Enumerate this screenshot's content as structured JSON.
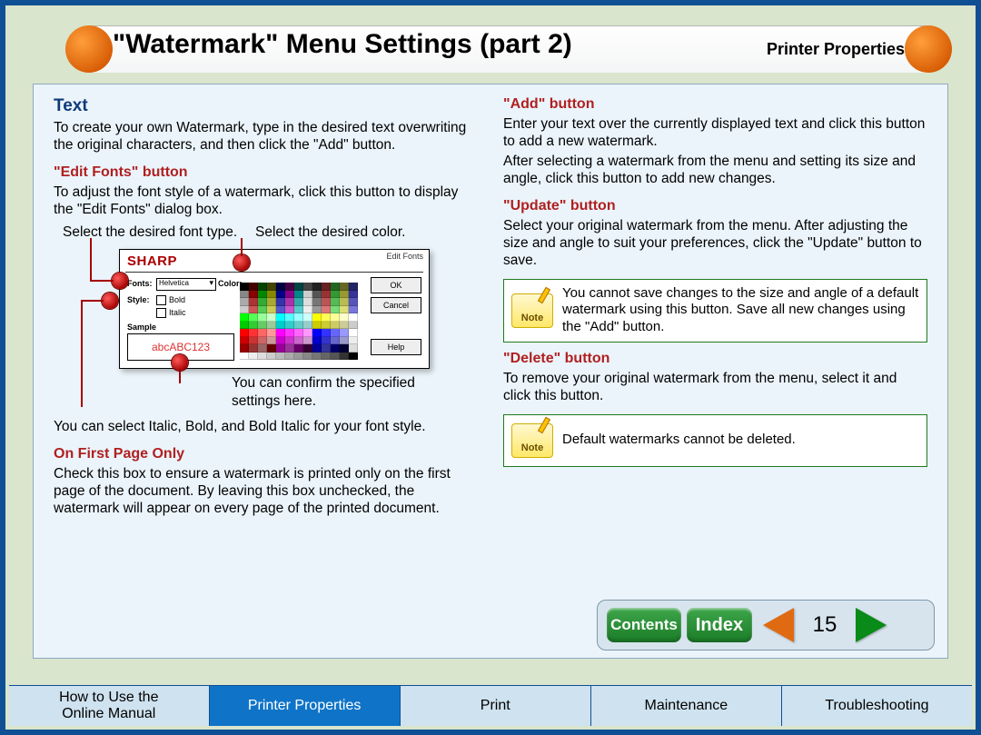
{
  "header": {
    "title": "\"Watermark\" Menu Settings (part 2)",
    "subtitle": "Printer Properties"
  },
  "left": {
    "text_heading": "Text",
    "text_body": "To create your own Watermark, type in the desired text overwriting the original characters, and then click the \"Add\" button.",
    "editfonts_heading": "\"Edit Fonts\" button",
    "editfonts_body": "To adjust the font style of a watermark, click this button to display the \"Edit Fonts\" dialog box.",
    "callout_fonttype": "Select the desired font type.",
    "callout_color": "Select the desired color.",
    "callout_confirm": "You can confirm the specified settings here.",
    "callout_style": "You can select Italic, Bold, and Bold Italic for your font style.",
    "firstpage_heading": "On First Page Only",
    "firstpage_body": "Check this box to ensure a watermark is printed only on the first page of the document. By leaving this box unchecked, the watermark will appear on every page of the printed document."
  },
  "right": {
    "add_heading": "\"Add\" button",
    "add_body1": "Enter your text over the currently displayed text and click this button to add a new watermark.",
    "add_body2": "After selecting a watermark from the menu and setting its size and angle, click this button to add new changes.",
    "update_heading": "\"Update\" button",
    "update_body": "Select your original watermark from the menu. After adjusting the size and angle to suit your preferences, click the \"Update\" button to save.",
    "note1": "You cannot save changes to the size and angle of a default watermark using this button. Save all new changes using the \"Add\" button.",
    "delete_heading": "\"Delete\" button",
    "delete_body": "To remove your original watermark from the menu, select it and click this button.",
    "note2": "Default watermarks cannot be deleted."
  },
  "editfonts_dialog": {
    "title": "Edit Fonts",
    "brand": "SHARP",
    "fonts_label": "Fonts:",
    "fonts_value": "Helvetica",
    "style_label": "Style:",
    "bold": "Bold",
    "italic": "Italic",
    "color_label": "Color:",
    "sample_label": "Sample",
    "sample_text": "abcABC123",
    "ok": "OK",
    "cancel": "Cancel",
    "help": "Help"
  },
  "note_label": "Note",
  "nav": {
    "contents": "Contents",
    "index": "Index",
    "page": "15"
  },
  "tabs": [
    "How to Use the\nOnline Manual",
    "Printer Properties",
    "Print",
    "Maintenance",
    "Troubleshooting"
  ],
  "tabs_selected_index": 1
}
